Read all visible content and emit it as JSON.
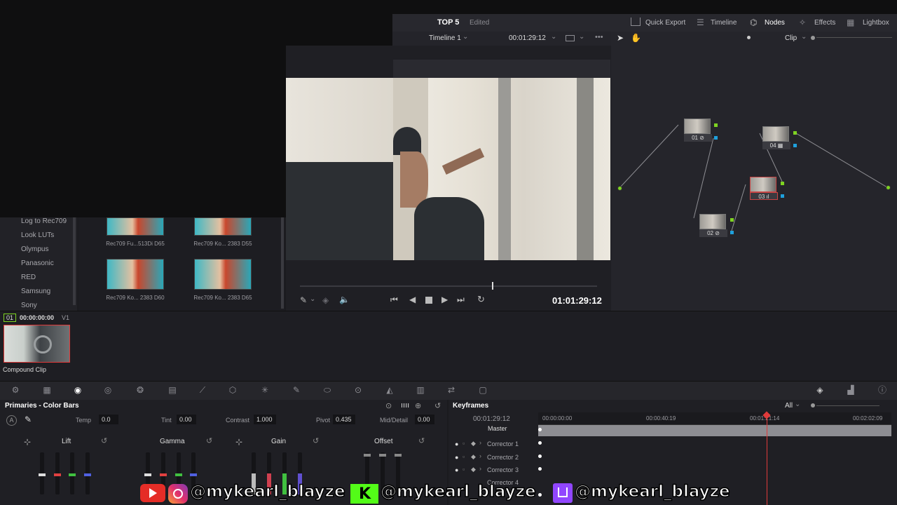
{
  "project": {
    "title": "TOP 5",
    "status": "Edited"
  },
  "top_nav": [
    {
      "label": "Quick Export",
      "icon": "export-icon"
    },
    {
      "label": "Timeline",
      "icon": "timeline-icon"
    },
    {
      "label": "Nodes",
      "icon": "nodes-icon"
    },
    {
      "label": "Effects",
      "icon": "effects-icon"
    },
    {
      "label": "Lightbox",
      "icon": "lightbox-icon"
    }
  ],
  "viewer": {
    "timeline_name": "Timeline 1",
    "timecode_top": "00:01:29:12",
    "timecode": "01:01:29:12"
  },
  "node_editor": {
    "mode": "Clip",
    "nodes": [
      "01",
      "02",
      "03",
      "04"
    ]
  },
  "lut_categories": [
    "Log to Rec709",
    "Look LUTs",
    "Olympus",
    "Panasonic",
    "RED",
    "Samsung",
    "Sony"
  ],
  "luts": [
    "Rec709 Fu...513Di D65",
    "Rec709 Ko... 2383 D55",
    "Rec709 Ko... 2383 D60",
    "Rec709 Ko... 2383 D65"
  ],
  "clip": {
    "index": "01",
    "timecode": "00:00:00:00",
    "track": "V1",
    "name": "Compound Clip"
  },
  "primaries": {
    "title": "Primaries - Color Bars",
    "temp_label": "Temp",
    "temp": "0.0",
    "tint_label": "Tint",
    "tint": "0.00",
    "contrast_label": "Contrast",
    "contrast": "1.000",
    "pivot_label": "Pivot",
    "pivot": "0.435",
    "mid_label": "Mid/Detail",
    "mid": "0.00",
    "wheels": [
      "Lift",
      "Gamma",
      "Gain",
      "Offset"
    ]
  },
  "keyframes": {
    "title": "Keyframes",
    "filter": "All",
    "timecode": "00:01:29:12",
    "ruler": [
      "00:00:00:00",
      "00:00:40:19",
      "00:01:21:14",
      "00:02:02:09"
    ],
    "tracks": [
      "Master",
      "Corrector 1",
      "Corrector 2",
      "Corrector 3",
      "Corrector 4"
    ]
  },
  "watermarks": [
    "@mykearl_blayze",
    "@mykearl_blayze",
    "@mykearl_blayze"
  ],
  "colors": {
    "accent_red": "#e03a3a",
    "node_green": "#7ed321",
    "node_blue": "#1ea0dc"
  }
}
